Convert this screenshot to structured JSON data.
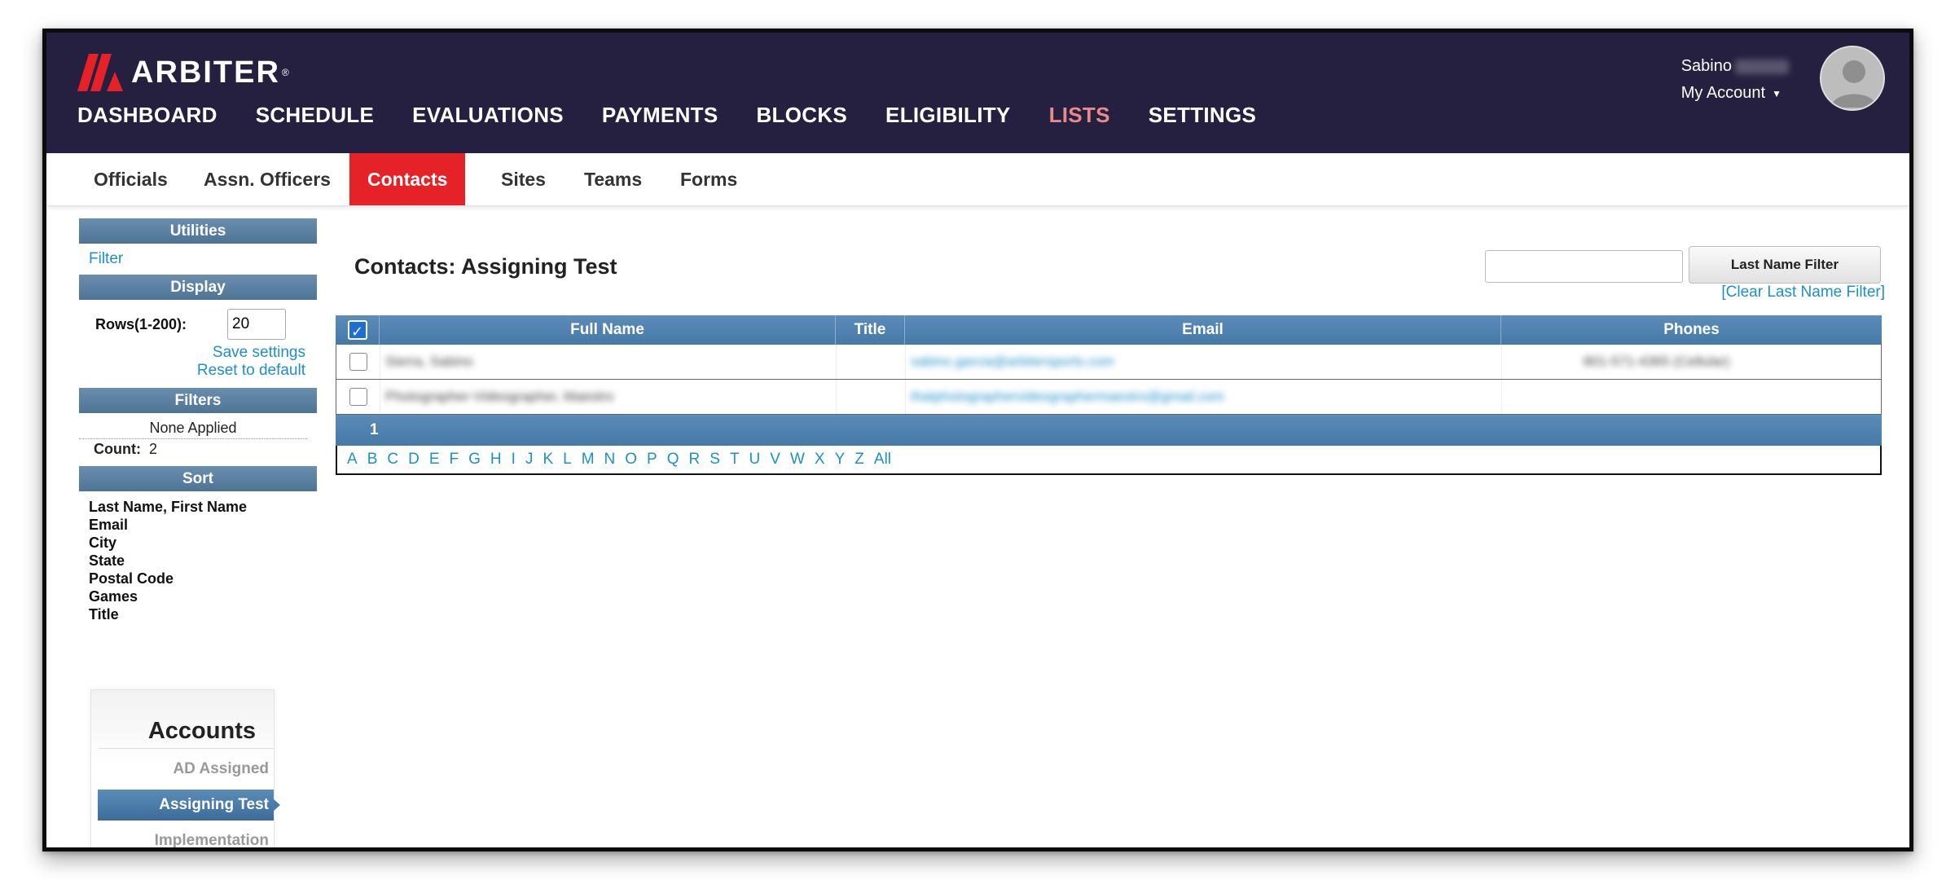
{
  "brand": {
    "name": "ARBITER",
    "reg": "®",
    "mark_color": "#e52228"
  },
  "main_nav": [
    {
      "label": "DASHBOARD",
      "active": false
    },
    {
      "label": "SCHEDULE",
      "active": false
    },
    {
      "label": "EVALUATIONS",
      "active": false
    },
    {
      "label": "PAYMENTS",
      "active": false
    },
    {
      "label": "BLOCKS",
      "active": false
    },
    {
      "label": "ELIGIBILITY",
      "active": false
    },
    {
      "label": "LISTS",
      "active": true
    },
    {
      "label": "SETTINGS",
      "active": false
    }
  ],
  "user": {
    "first_name": "Sabino",
    "account_label": "My Account"
  },
  "sub_nav": [
    {
      "label": "Officials",
      "active": false
    },
    {
      "label": "Assn. Officers",
      "active": false
    },
    {
      "label": "Contacts",
      "active": true
    },
    {
      "label": "Sites",
      "active": false
    },
    {
      "label": "Teams",
      "active": false
    },
    {
      "label": "Forms",
      "active": false
    }
  ],
  "sidebar": {
    "utilities_header": "Utilities",
    "filter_link": "Filter",
    "display_header": "Display",
    "rows_label": "Rows(1-200):",
    "rows_value": "20",
    "save_settings": "Save settings",
    "reset_default": "Reset to default",
    "filters_header": "Filters",
    "none_applied": "None Applied",
    "count_label": "Count:",
    "count_value": "2",
    "sort_header": "Sort",
    "sort_items": [
      "Last Name, First Name",
      "Email",
      "City",
      "State",
      "Postal Code",
      "Games",
      "Title"
    ]
  },
  "accounts": {
    "title": "Accounts",
    "items": [
      {
        "label": "AD Assigned",
        "active": false
      },
      {
        "label": "Assigning Test",
        "active": true
      },
      {
        "label": "Implementation",
        "active": false
      }
    ]
  },
  "main": {
    "title": "Contacts: Assigning Test",
    "filter_placeholder": "",
    "filter_button": "Last Name Filter",
    "clear_filter": "[Clear Last Name Filter]"
  },
  "table": {
    "columns": [
      "Full Name",
      "Title",
      "Email",
      "Phones"
    ],
    "rows": [
      {
        "name": "Sierra, Sabino",
        "title": "",
        "email": "sabino.garcia@arbitersports.com",
        "phone": "801-571-4365 (Cellular)"
      },
      {
        "name": "Photographer-Videographer, Maestro",
        "title": "",
        "email": "thatphotographervideographermaestro@gmail.com",
        "phone": ""
      }
    ],
    "page": "1",
    "alphabet": [
      "A",
      "B",
      "C",
      "D",
      "E",
      "F",
      "G",
      "H",
      "I",
      "J",
      "K",
      "L",
      "M",
      "N",
      "O",
      "P",
      "Q",
      "R",
      "S",
      "T",
      "U",
      "V",
      "W",
      "X",
      "Y",
      "Z",
      "All"
    ]
  }
}
